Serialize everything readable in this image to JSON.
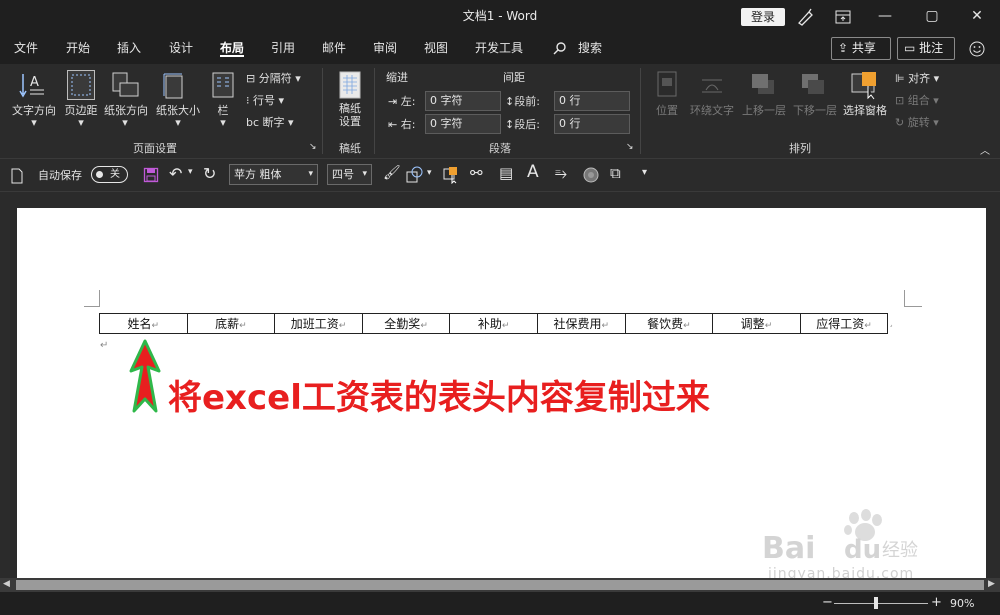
{
  "window": {
    "title": "文档1  -  Word",
    "login_label": "登录",
    "minimize": "—",
    "restore": "▢",
    "close": "✕"
  },
  "menu": {
    "items": [
      "文件",
      "开始",
      "插入",
      "设计",
      "布局",
      "引用",
      "邮件",
      "审阅",
      "视图",
      "开发工具"
    ],
    "active": "布局",
    "search_label": "搜索",
    "share_label": "共享",
    "comment_label": "批注"
  },
  "ribbon": {
    "page_setup": {
      "label": "页面设置",
      "buttons": [
        "文字方向",
        "页边距",
        "纸张方向",
        "纸张大小",
        "栏"
      ],
      "small": [
        "分隔符",
        "行号",
        "断字"
      ]
    },
    "manuscript": {
      "label": "稿纸",
      "button": "稿纸\n设置"
    },
    "paragraph": {
      "label": "段落",
      "indent_title": "缩进",
      "spacing_title": "间距",
      "indent_left_label": "左:",
      "indent_right_label": "右:",
      "indent_left_value": "0 字符",
      "indent_right_value": "0 字符",
      "space_before_label": "段前:",
      "space_after_label": "段后:",
      "space_before_value": "0 行",
      "space_after_value": "0 行"
    },
    "arrange": {
      "label": "排列",
      "buttons": [
        "位置",
        "环绕文字",
        "上移一层",
        "下移一层",
        "选择窗格"
      ],
      "small": [
        "对齐",
        "组合",
        "旋转"
      ]
    }
  },
  "qat": {
    "autosave_label": "自动保存",
    "toggle_label": "关",
    "font_name": "苹方 粗体",
    "font_size": "四号"
  },
  "document": {
    "table_headers": [
      "姓名",
      "底薪",
      "加班工资",
      "全勤奖",
      "补助",
      "社保费用",
      "餐饮费",
      "调整",
      "应得工资"
    ],
    "para_mark": "↵",
    "annotation": "将excel工资表的表头内容复制过来"
  },
  "watermark": {
    "brand": "Bai du 经验",
    "url": "jingyan.baidu.com"
  },
  "status": {
    "zoom": "90%",
    "zoom_level": 0.9
  }
}
